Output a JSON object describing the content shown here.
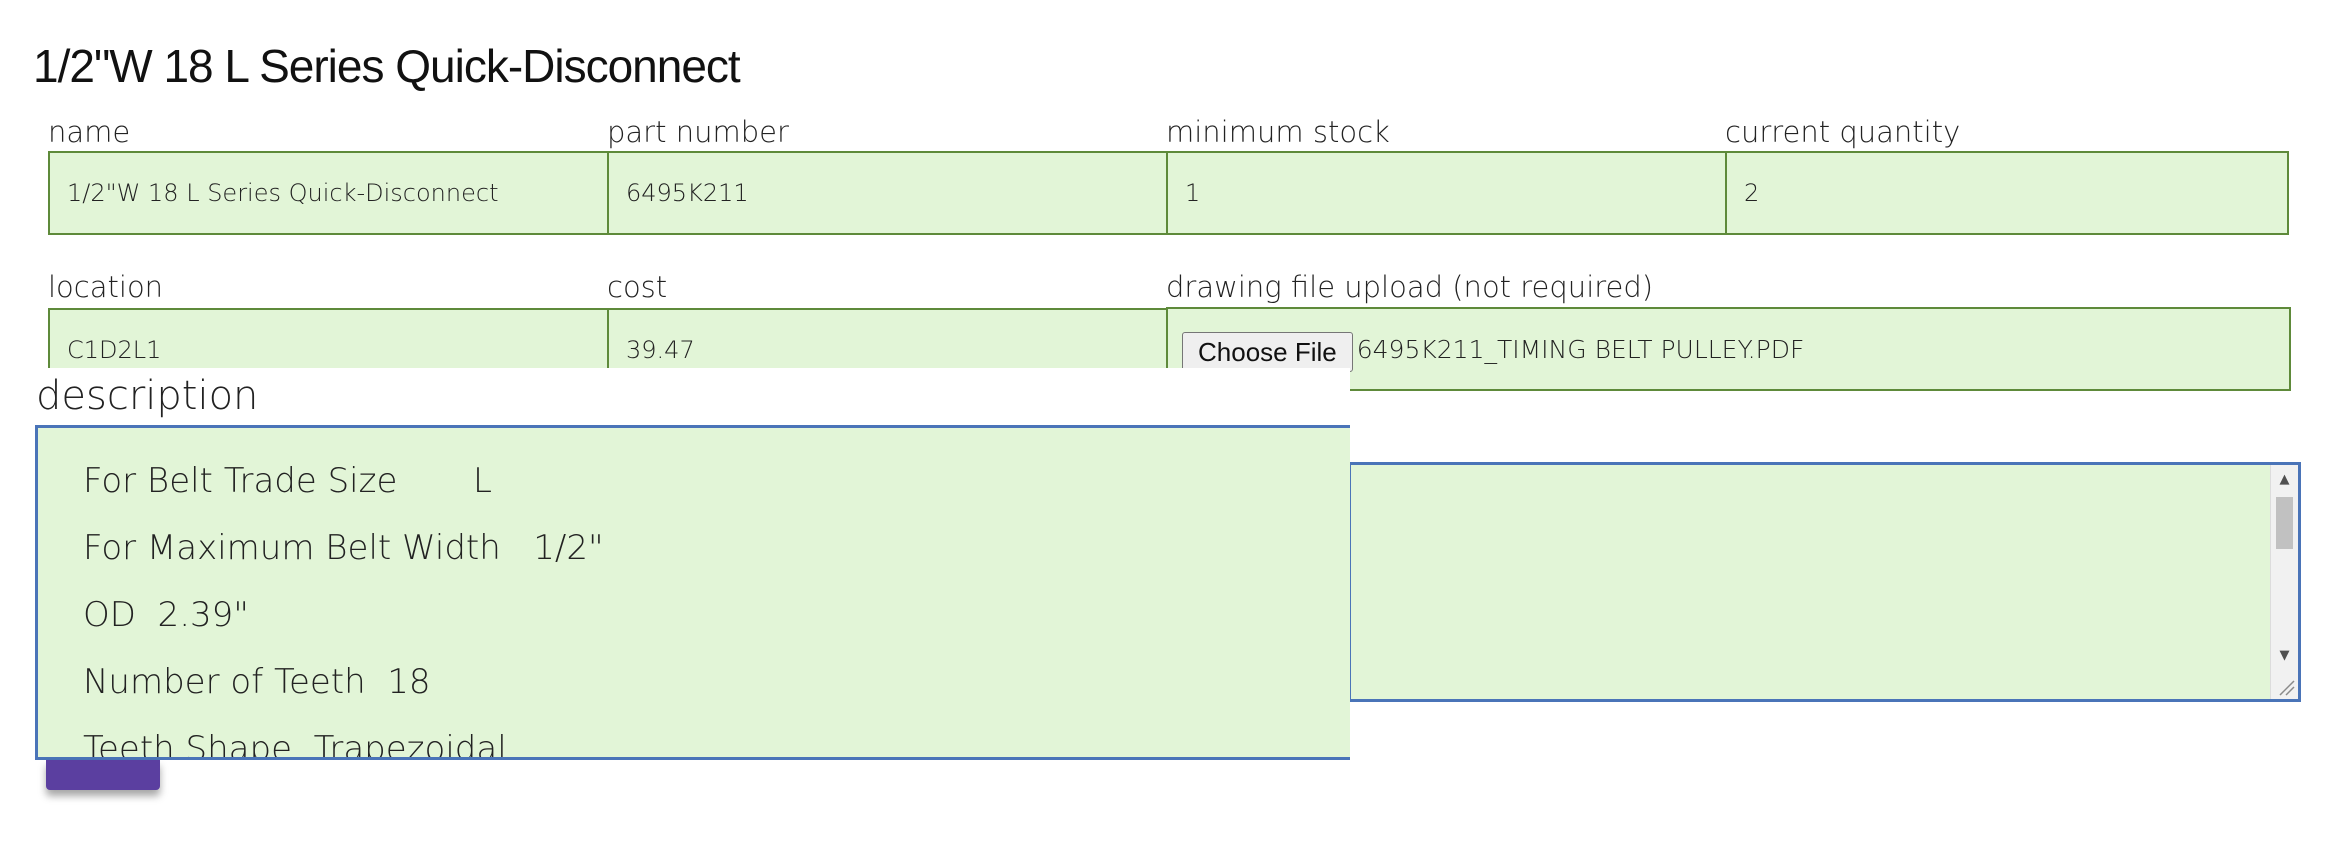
{
  "page": {
    "title": "1/2\"W 18 L Series Quick-Disconnect"
  },
  "fields": {
    "name": {
      "label": "name",
      "value": "1/2\"W 18 L Series Quick-Disconnect"
    },
    "part_number": {
      "label": "part number",
      "value": "6495K211"
    },
    "minimum_stock": {
      "label": "minimum stock",
      "value": "1"
    },
    "current_quantity": {
      "label": "current quantity",
      "value": "2"
    },
    "location": {
      "label": "location",
      "value": "C1D2L1"
    },
    "cost": {
      "label": "cost",
      "value": "39.47"
    },
    "drawing_file": {
      "label": "drawing file upload (not required)",
      "button_label": "Choose File",
      "file_name": "6495K211_TIMING BELT PULLEY.PDF"
    }
  },
  "description": {
    "label": "description",
    "lines": [
      "For Belt Trade Size       L",
      "For Maximum Belt Width   1/2\"",
      "OD  2.39\"",
      "Number of Teeth  18",
      "Teeth Shape  Trapezoidal"
    ]
  },
  "colors": {
    "field_background": "#e2f5d7",
    "field_border": "#5e8a3a",
    "textarea_border": "#4a74b8",
    "submit_button": "#5b3fa0"
  },
  "icons": {
    "scroll_up": "scroll-up-arrow-icon",
    "scroll_down": "scroll-down-arrow-icon",
    "resize": "resize-grip-icon"
  }
}
